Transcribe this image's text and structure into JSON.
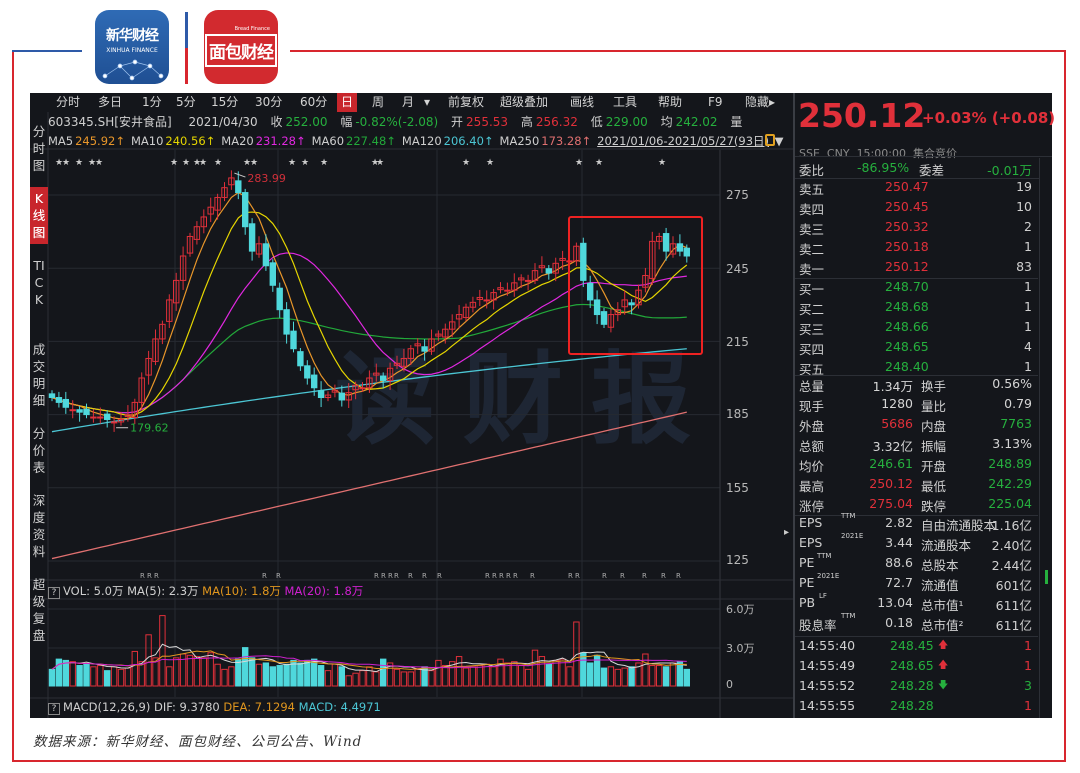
{
  "logos": {
    "xinhua": {
      "cn": "新华财经",
      "en": "XINHUA FINANCE"
    },
    "mianbao": {
      "cn": "面包财经",
      "en": "Bread Finance"
    }
  },
  "toolbar": {
    "items": [
      "分时",
      "多日",
      "1分",
      "5分",
      "15分",
      "30分",
      "60分",
      "日",
      "周",
      "月",
      "▾",
      "前复权",
      "超级叠加",
      "画线",
      "工具",
      "帮助",
      "F9",
      "隐藏▸"
    ],
    "active": "日"
  },
  "sidebar": {
    "tabs": [
      "分时图",
      "K线图",
      "TICK",
      "成交明细",
      "分价表",
      "深度资料",
      "超级复盘"
    ],
    "active": "K线图"
  },
  "info": {
    "code": "603345.SH[安井食品]",
    "date": "2021/04/30",
    "close_label": "收",
    "close": "252.00",
    "change_label": "幅",
    "change": "-0.82%(-2.08)",
    "open_label": "开",
    "open": "255.53",
    "high_label": "高",
    "high": "256.32",
    "low_label": "低",
    "low": "229.00",
    "avg_label": "均",
    "avg": "242.02",
    "vol_label": "量"
  },
  "ma_legend": {
    "items": [
      {
        "label": "MA5",
        "value": "245.92↑",
        "color": "#e8962a"
      },
      {
        "label": "MA10",
        "value": "240.56↑",
        "color": "#e6d600"
      },
      {
        "label": "MA20",
        "value": "231.28↑",
        "color": "#e028e0"
      },
      {
        "label": "MA60",
        "value": "227.48↑",
        "color": "#22a83a"
      },
      {
        "label": "MA120",
        "value": "206.40↑",
        "color": "#4cc6d4"
      },
      {
        "label": "MA250",
        "value": "173.28↑",
        "color": "#e07070"
      }
    ],
    "range": "2021/01/06-2021/05/27(93日)"
  },
  "watermark": "读财报",
  "chart_data": {
    "type": "candlestick",
    "price_axis_ticks": [
      "275",
      "245",
      "215",
      "185",
      "155",
      "125"
    ],
    "ylim": [
      115,
      293
    ],
    "close": [
      192,
      190,
      188,
      187,
      186,
      185,
      184,
      184,
      183,
      182,
      183,
      185,
      190,
      200,
      208,
      216,
      222,
      232,
      240,
      250,
      258,
      262,
      266,
      270,
      274,
      278,
      282,
      276,
      262,
      252,
      255,
      246,
      238,
      228,
      218,
      212,
      205,
      200,
      196,
      192,
      193,
      195,
      191,
      194,
      197,
      196,
      200,
      202,
      199,
      204,
      206,
      208,
      212,
      214,
      211,
      216,
      218,
      220,
      223,
      226,
      229,
      231,
      233,
      232,
      235,
      237,
      236,
      239,
      241,
      240,
      244,
      246,
      243,
      247,
      249,
      248,
      254,
      240,
      232,
      226,
      222,
      226,
      228,
      232,
      230,
      236,
      242,
      256,
      258,
      252,
      255,
      252,
      250
    ],
    "high_label": "283.99",
    "low_label": "179.62",
    "ma120_range": [
      178,
      212
    ],
    "ma250_range": [
      126,
      186
    ],
    "volume": {
      "header": {
        "vol": "VOL: 5.0万",
        "ma5": "MA(5): 2.3万",
        "ma10": "MA(10): 1.8万",
        "ma20": "MA(20): 1.8万"
      },
      "axis_ticks": [
        "6.0万",
        "3.0万",
        "0"
      ],
      "ylim": [
        0,
        6
      ],
      "values": [
        1.3,
        2.1,
        2.0,
        1.9,
        1.6,
        1.7,
        1.5,
        1.6,
        1.2,
        1.5,
        1.3,
        1.4,
        2.7,
        1.9,
        4.0,
        2.2,
        5.5,
        1.5,
        2.2,
        2.5,
        2.4,
        2.3,
        2.2,
        2.6,
        1.7,
        1.3,
        1.5,
        2.1,
        3.0,
        2.2,
        1.7,
        1.8,
        1.5,
        1.6,
        1.7,
        2.0,
        1.8,
        2.0,
        2.1,
        1.6,
        1.2,
        1.7,
        1.5,
        0.8,
        1.0,
        1.2,
        1.5,
        1.1,
        2.1,
        1.8,
        1.3,
        1.1,
        1.1,
        1.3,
        1.5,
        1.2,
        2.0,
        1.6,
        1.9,
        2.3,
        1.4,
        1.5,
        1.6,
        1.7,
        1.5,
        2.1,
        1.8,
        1.9,
        1.6,
        1.3,
        2.8,
        2.3,
        1.7,
        2.0,
        2.1,
        1.5,
        5.0,
        2.6,
        1.8,
        2.4,
        1.4,
        1.5,
        1.3,
        1.4,
        1.5,
        1.8,
        2.5,
        1.6,
        1.6,
        1.5,
        1.8,
        1.9,
        1.3
      ]
    },
    "macd": {
      "label": "MACD(12,26,9)",
      "dif": "DIF: 9.3780",
      "dea": "DEA: 7.1294",
      "macd": "MACD: 4.4971"
    }
  },
  "quote": {
    "price": "250.12",
    "change": "+0.03% (+0.08)",
    "exchange": "SSE",
    "currency": "CNY",
    "time": "15:00:00",
    "status": "集合竞价",
    "wb_label": "委比",
    "wb": "-86.95%",
    "wc_label": "委差",
    "wc": "-0.01万",
    "sell": [
      {
        "label": "卖五",
        "price": "250.47",
        "qty": "19"
      },
      {
        "label": "卖四",
        "price": "250.45",
        "qty": "10"
      },
      {
        "label": "卖三",
        "price": "250.32",
        "qty": "2"
      },
      {
        "label": "卖二",
        "price": "250.18",
        "qty": "1"
      },
      {
        "label": "卖一",
        "price": "250.12",
        "qty": "83"
      }
    ],
    "buy": [
      {
        "label": "买一",
        "price": "248.70",
        "qty": "1"
      },
      {
        "label": "买二",
        "price": "248.68",
        "qty": "1"
      },
      {
        "label": "买三",
        "price": "248.66",
        "qty": "1"
      },
      {
        "label": "买四",
        "price": "248.65",
        "qty": "4"
      },
      {
        "label": "买五",
        "price": "248.40",
        "qty": "1"
      }
    ],
    "stats": [
      {
        "l1": "总量",
        "v1": "1.34万",
        "c1": "w",
        "l2": "换手",
        "v2": "0.56%",
        "c2": "w"
      },
      {
        "l1": "现手",
        "v1": "1280",
        "c1": "w",
        "l2": "量比",
        "v2": "0.79",
        "c2": "w"
      },
      {
        "l1": "外盘",
        "v1": "5686",
        "c1": "r",
        "l2": "内盘",
        "v2": "7763",
        "c2": "g"
      },
      {
        "l1": "总额",
        "v1": "3.32亿",
        "c1": "w",
        "l2": "振幅",
        "v2": "3.13%",
        "c2": "w"
      },
      {
        "l1": "均价",
        "v1": "246.61",
        "c1": "g",
        "l2": "开盘",
        "v2": "248.89",
        "c2": "g"
      },
      {
        "l1": "最高",
        "v1": "250.12",
        "c1": "r",
        "l2": "最低",
        "v2": "242.29",
        "c2": "g"
      },
      {
        "l1": "涨停",
        "v1": "275.04",
        "c1": "r",
        "l2": "跌停",
        "v2": "225.04",
        "c2": "g"
      }
    ],
    "fundamentals": [
      {
        "l1": "EPS",
        "s1": "TTM",
        "v1": "2.82",
        "l2": "自由流通股本",
        "v2": "1.16亿"
      },
      {
        "l1": "EPS",
        "s1": "2021E",
        "v1": "3.44",
        "l2": "流通股本",
        "v2": "2.40亿"
      },
      {
        "l1": "PE",
        "s1": "TTM",
        "v1": "88.6",
        "l2": "总股本",
        "v2": "2.44亿"
      },
      {
        "l1": "PE",
        "s1": "2021E",
        "v1": "72.7",
        "l2": "流通值",
        "v2": "601亿"
      },
      {
        "l1": "PB",
        "s1": "LF",
        "v1": "13.04",
        "l2": "总市值¹",
        "v2": "611亿"
      },
      {
        "l1": "股息率",
        "s1": "TTM",
        "v1": "0.18",
        "l2": "总市值²",
        "v2": "611亿"
      }
    ],
    "ticks": [
      {
        "time": "14:55:40",
        "price": "248.45",
        "dir": "up",
        "qty": "1",
        "qc": "r"
      },
      {
        "time": "14:55:49",
        "price": "248.65",
        "dir": "up",
        "qty": "1",
        "qc": "r"
      },
      {
        "time": "14:55:52",
        "price": "248.28",
        "dir": "down",
        "qty": "3",
        "qc": "g"
      },
      {
        "time": "14:55:55",
        "price": "248.28",
        "dir": "",
        "qty": "1",
        "qc": "r"
      }
    ],
    "arrows": {
      "up": "🡅",
      "down": "🡇"
    }
  },
  "caption": "数据来源：新华财经、面包财经、公司公告、Wind"
}
